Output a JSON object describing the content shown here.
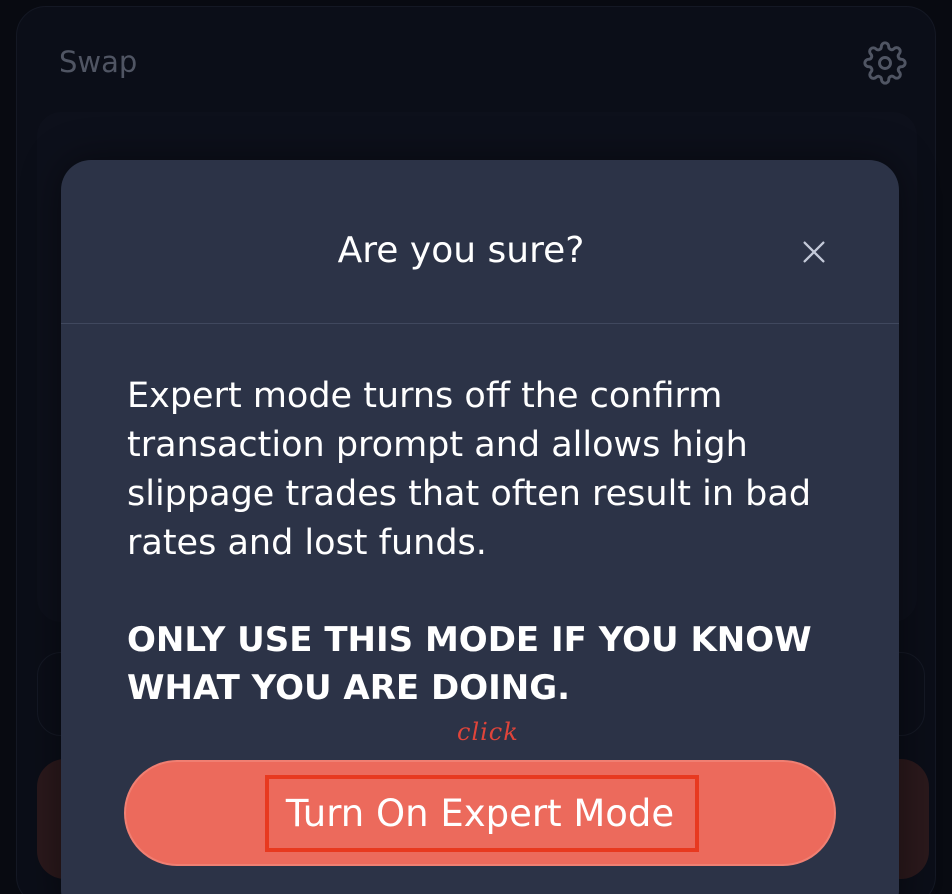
{
  "swap": {
    "title": "Swap",
    "settings_icon": "gear-icon"
  },
  "modal": {
    "title": "Are you sure?",
    "close_icon": "close-icon",
    "warning": "Expert mode turns off the confirm transaction prompt and allows high slippage trades that often result in bad rates and lost funds.",
    "caution": "ONLY USE THIS MODE IF YOU KNOW WHAT YOU ARE DOING.",
    "confirm_label": "Turn On Expert Mode"
  },
  "annotation": {
    "label": "click",
    "color": "#e8391f"
  },
  "colors": {
    "modal_bg": "#2c3347",
    "accent": "#ec6a5c",
    "page_bg": "#0b0e17"
  }
}
